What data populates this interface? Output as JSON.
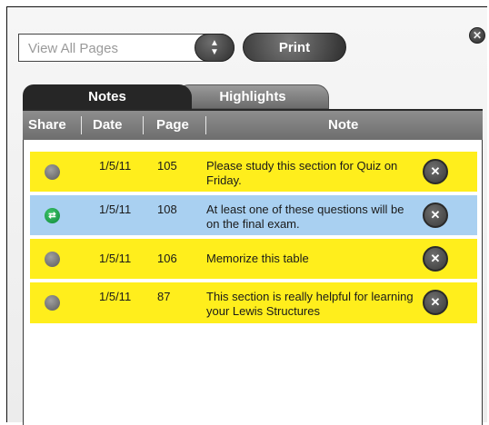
{
  "controls": {
    "view_select_value": "View All Pages",
    "print_label": "Print",
    "close_symbol": "✕"
  },
  "tabs": [
    {
      "label": "Notes",
      "active": true
    },
    {
      "label": "Highlights",
      "active": false
    }
  ],
  "columns": [
    "Share",
    "Date",
    "Page",
    "Note"
  ],
  "notes": [
    {
      "shared": false,
      "date": "1/5/11",
      "page": "105",
      "note": "Please study this section for Quiz on Friday.",
      "color": "#ffee1c"
    },
    {
      "shared": true,
      "date": "1/5/11",
      "page": "108",
      "note": "At least one of these questions will be on the final exam.",
      "color": "#a9d0f1"
    },
    {
      "shared": false,
      "date": "1/5/11",
      "page": "106",
      "note": "Memorize this table",
      "color": "#ffee1c"
    },
    {
      "shared": false,
      "date": "1/5/11",
      "page": "87",
      "note": "This section is really helpful for learning your Lewis Structures",
      "color": "#ffee1c"
    }
  ],
  "icons": {
    "close": "close-icon",
    "stepper": "up-down-arrows-icon",
    "share_on": "share-arrows-icon",
    "delete": "delete-x-icon"
  }
}
